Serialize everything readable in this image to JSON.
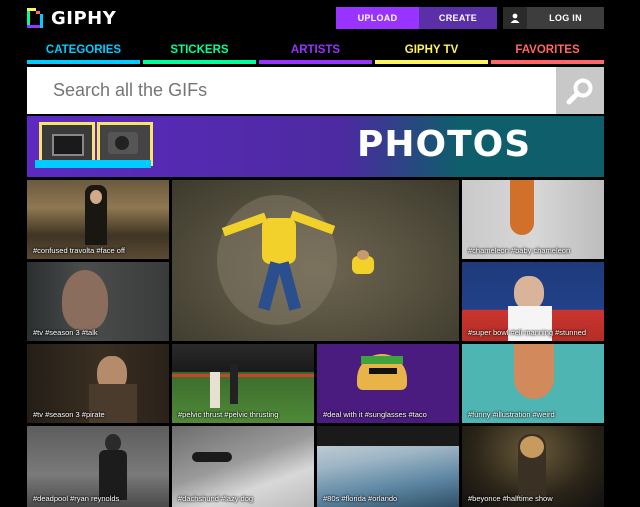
{
  "header": {
    "logo_text": "GIPHY",
    "upload_label": "UPLOAD",
    "create_label": "CREATE",
    "login_label": "LOG IN"
  },
  "nav": [
    {
      "label": "CATEGORIES",
      "color": "#00ccff"
    },
    {
      "label": "STICKERS",
      "color": "#00ff99"
    },
    {
      "label": "ARTISTS",
      "color": "#9933ff"
    },
    {
      "label": "GIPHY TV",
      "color": "#fff35c"
    },
    {
      "label": "FAVORITES",
      "color": "#ff6666"
    }
  ],
  "search": {
    "placeholder": "Search all the GIFs"
  },
  "banner": {
    "title": "PHOTOS"
  },
  "tiles": [
    {
      "tags": "#confused travolta #face off"
    },
    {
      "tags": "#tv #season 3 #talk"
    },
    {
      "tags": ""
    },
    {
      "tags": "#chameleon #baby chameleon"
    },
    {
      "tags": "#super bowl #eli manning #stunned"
    },
    {
      "tags": "#tv #season 3 #pirate"
    },
    {
      "tags": "#pelvic thrust #pelvic thrusting"
    },
    {
      "tags": "#deal with it #sunglasses #taco"
    },
    {
      "tags": "#funny #illustration #weird"
    },
    {
      "tags": "#deadpool #ryan reynolds"
    },
    {
      "tags": "#dachshund #lazy dog"
    },
    {
      "tags": "#80s #florida #orlando"
    },
    {
      "tags": "#beyonce #halftime show"
    }
  ]
}
